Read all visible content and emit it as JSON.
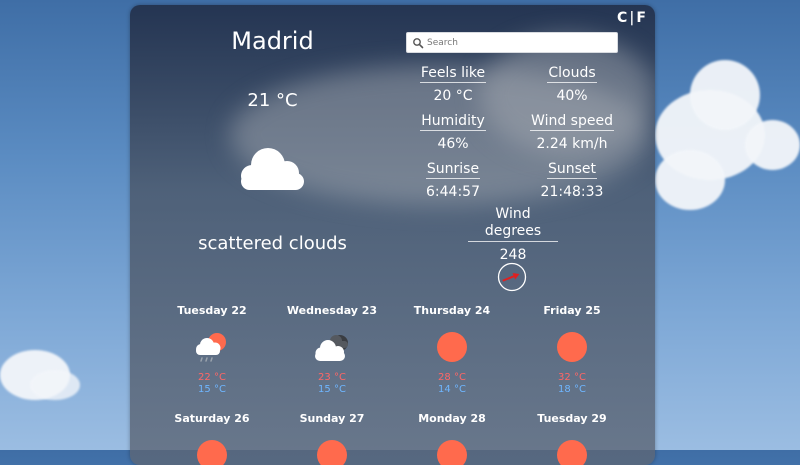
{
  "weather": {
    "city": "Madrid",
    "temperature": "21 °C",
    "description": "scattered clouds",
    "icon": "cloud-icon"
  },
  "units": {
    "celsius": "C",
    "separator": "|",
    "fahrenheit": "F",
    "selected": "C"
  },
  "search": {
    "placeholder": "Search",
    "value": ""
  },
  "stats": {
    "feels_like": {
      "label": "Feels like",
      "value": "20 °C"
    },
    "clouds": {
      "label": "Clouds",
      "value": "40%"
    },
    "humidity": {
      "label": "Humidity",
      "value": "46%"
    },
    "wind_speed": {
      "label": "Wind speed",
      "value": "2.24 km/h"
    },
    "sunrise": {
      "label": "Sunrise",
      "value": "6:44:57"
    },
    "sunset": {
      "label": "Sunset",
      "value": "21:48:33"
    },
    "wind_degrees": {
      "label": "Wind degrees",
      "value": "248"
    }
  },
  "forecast": [
    {
      "day": "Tuesday 22",
      "icon": "sun-rain-cloud-icon",
      "high": "22 °C",
      "low": "15 °C"
    },
    {
      "day": "Wednesday 23",
      "icon": "cloud-sun-icon",
      "high": "23 °C",
      "low": "15 °C"
    },
    {
      "day": "Thursday 24",
      "icon": "sun-icon",
      "high": "28 °C",
      "low": "14 °C"
    },
    {
      "day": "Friday 25",
      "icon": "sun-icon",
      "high": "32 °C",
      "low": "18 °C"
    },
    {
      "day": "Saturday 26",
      "icon": "sun-icon",
      "high": "",
      "low": ""
    },
    {
      "day": "Sunday 27",
      "icon": "sun-icon",
      "high": "",
      "low": ""
    },
    {
      "day": "Monday 28",
      "icon": "sun-icon",
      "high": "",
      "low": ""
    },
    {
      "day": "Tuesday 29",
      "icon": "sun-icon",
      "high": "",
      "low": ""
    }
  ],
  "colors": {
    "high_temp": "#ff6666",
    "low_temp": "#6fb6ff",
    "sun": "#ff6a4d",
    "wind_arrow": "#e02020"
  }
}
